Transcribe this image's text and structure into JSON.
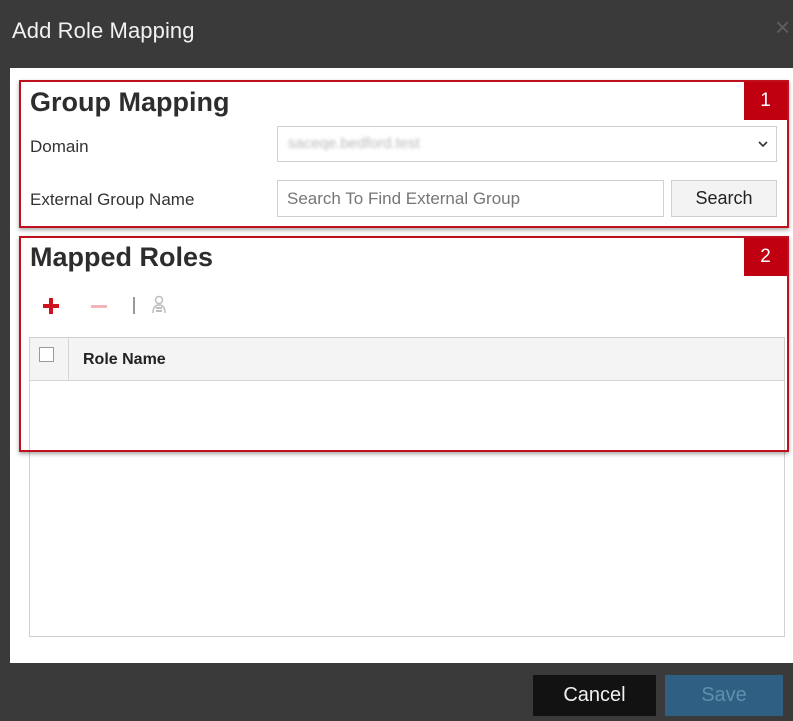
{
  "dialog": {
    "title": "Add Role Mapping"
  },
  "group_mapping": {
    "heading": "Group Mapping",
    "domain_label": "Domain",
    "domain_value": "saceqe.bedford.test",
    "external_group_label": "External Group Name",
    "external_group_value": "",
    "external_group_placeholder": "Search To Find External Group",
    "search_button": "Search"
  },
  "mapped_roles": {
    "heading": "Mapped Roles",
    "toolbar_icons": [
      "add-icon",
      "remove-icon",
      "separator",
      "role-icon"
    ],
    "columns": [
      "Role Name"
    ],
    "rows": []
  },
  "callouts": [
    "1",
    "2"
  ],
  "footer": {
    "cancel_label": "Cancel",
    "save_label": "Save"
  },
  "colors": {
    "chrome": "#3a3a3a",
    "callout_red": "#c00010",
    "save_disabled": "#2f5f82",
    "add_icon_red": "#d0121f"
  }
}
